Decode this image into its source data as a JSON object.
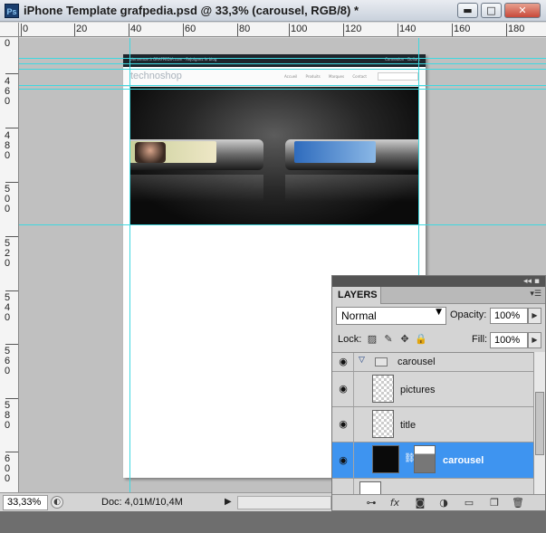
{
  "window": {
    "title": "iPhone Template grafpedia.psd @ 33,3% (carousel, RGB/8) *",
    "app_badge": "Ps"
  },
  "ruler": {
    "top_labels": [
      "0",
      "20",
      "40",
      "60",
      "80",
      "100",
      "120",
      "140",
      "160",
      "180"
    ],
    "left_labels": [
      "0",
      "4 6 0",
      "4 8 0",
      "5 0 0",
      "5 2 0",
      "5 4 0",
      "5 6 0",
      "5 8 0",
      "6 0 0"
    ]
  },
  "document": {
    "topbar_text": "bienvenue à GRAFPEDIA.com · Rejoignez le blog",
    "topbar_right": "Connexion · Dollars",
    "logo": "technoshop",
    "nav": "Accueil  Produits  Marques  Contact"
  },
  "status": {
    "zoom": "33,33%",
    "doc_size": "Doc: 4,01M/10,4M"
  },
  "layers_panel": {
    "tab": "LAYERS",
    "blend_mode": "Normal",
    "opacity_label": "Opacity:",
    "opacity": "100%",
    "lock_label": "Lock:",
    "fill_label": "Fill:",
    "fill": "100%",
    "layers": [
      {
        "name": "carousel",
        "kind": "group",
        "selected": false
      },
      {
        "name": "pictures",
        "kind": "layer",
        "selected": false
      },
      {
        "name": "title",
        "kind": "layer",
        "selected": false
      },
      {
        "name": "carousel",
        "kind": "masked-layer",
        "selected": true
      }
    ]
  },
  "colors": {
    "guide": "#3fd8e0",
    "selection": "#3e94f0",
    "canvas_bg": "#c0c0c0"
  },
  "icons": [
    "photoshop-icon",
    "minimize-icon",
    "maximize-icon",
    "close-icon",
    "eye-icon",
    "folder-icon",
    "link-icon",
    "fx-icon",
    "mask-icon",
    "adjustment-icon",
    "new-group-icon",
    "new-layer-icon",
    "trash-icon"
  ]
}
